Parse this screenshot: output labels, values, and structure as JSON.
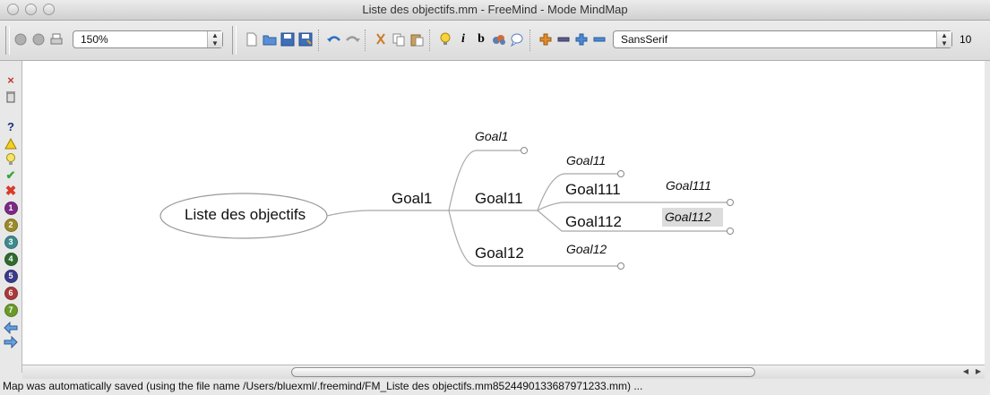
{
  "window": {
    "title": "Liste des objectifs.mm - FreeMind - Mode MindMap"
  },
  "toolbar": {
    "zoom_value": "150%",
    "font_name": "SansSerif",
    "font_size": "10",
    "icons": [
      "back-icon",
      "forward-icon",
      "print-icon",
      "new-file-icon",
      "open-file-icon",
      "save-icon",
      "save-as-icon",
      "undo-icon",
      "redo-icon",
      "cut-icon",
      "copy-icon",
      "paste-icon",
      "bulb-icon",
      "italic-icon",
      "bold-icon",
      "cloud-icon",
      "note-bubble-icon",
      "add-icon",
      "remove-icon",
      "add-child-icon",
      "remove-child-icon"
    ],
    "italic_label": "i",
    "bold_label": "b"
  },
  "left_panel": {
    "icons": [
      "remove-last-icon",
      "delete-all-icons",
      "question-icon",
      "warning-icon",
      "idea-icon",
      "ok-icon",
      "not-ok-icon",
      "priority-1-icon",
      "priority-2-icon",
      "priority-3-icon",
      "priority-4-icon",
      "priority-5-icon",
      "priority-6-icon",
      "priority-7-icon",
      "back-arrow-icon",
      "forward-arrow-icon"
    ],
    "priority_labels": [
      "1",
      "2",
      "3",
      "4",
      "5",
      "6",
      "7"
    ],
    "priority_colors": [
      "#7b2a84",
      "#9a8a2a",
      "#3e8a8c",
      "#2e6b2e",
      "#3a3a8a",
      "#a83a3a",
      "#6a9a2a"
    ]
  },
  "mindmap": {
    "root": "Liste des objectifs",
    "nodes": {
      "goal1": "Goal1",
      "goal1_note": "Goal1",
      "goal11": "Goal11",
      "goal11_note": "Goal11",
      "goal111": "Goal111",
      "goal111_note": "Goal111",
      "goal112": "Goal112",
      "goal112_note": "Goal112",
      "goal12": "Goal12",
      "goal12_note": "Goal12"
    },
    "edge_color": "#a8a8a8",
    "selected_highlight": "#dcdcdc"
  },
  "status": {
    "text": "Map was automatically saved (using the file name /Users/bluexml/.freemind/FM_Liste des objectifs.mm8524490133687971233.mm) ..."
  }
}
